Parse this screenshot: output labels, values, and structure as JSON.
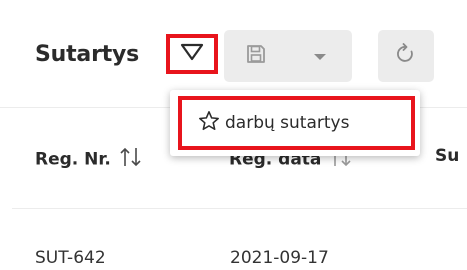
{
  "page": {
    "title": "Sutartys"
  },
  "toolbar": {
    "filter_icon": "triangle-down-icon",
    "save_icon": "floppy-disk-icon",
    "save_menu_icon": "caret-down-icon",
    "refresh_icon": "refresh-icon",
    "highlight_color": "#e8141c",
    "button_bg": "#ececec"
  },
  "dropdown": {
    "items": [
      {
        "icon": "star-outline-icon",
        "label": "darbų sutartys"
      }
    ]
  },
  "table": {
    "columns": [
      {
        "label": "Reg. Nr.",
        "sort_icon": "sort-icon"
      },
      {
        "label": "Reg. data",
        "sort_icon": "sort-icon"
      },
      {
        "label": "Su"
      }
    ],
    "rows": [
      {
        "reg_nr": "SUT-642",
        "reg_data": "2021-09-17"
      }
    ]
  }
}
